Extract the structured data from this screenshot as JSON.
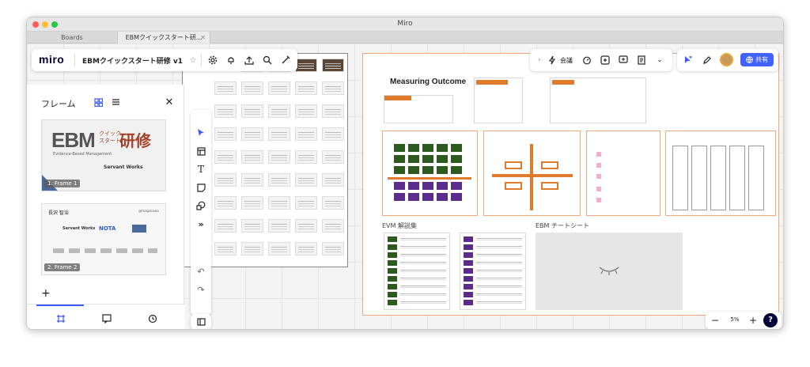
{
  "app": {
    "title": "Miro"
  },
  "tabs": [
    {
      "label": "Boards"
    },
    {
      "label": "EBMクイックスタート研..."
    }
  ],
  "toolbar": {
    "logo": "miro",
    "board_title": "EBMクイックスタート研修 v1",
    "meeting_label": "会議",
    "share_label": "共有"
  },
  "frames_panel": {
    "title": "フレーム",
    "frames": [
      {
        "label": "1. Frame 1",
        "title_big": "EBM",
        "title_small": "クイック\nスタート",
        "title_kanji": "研修",
        "subtitle": "Evidence-Based Management",
        "brand": "Servant Works"
      },
      {
        "label": "2. Frame 2",
        "name": "長沢 智治",
        "handle": "@tnagasawa",
        "brand": "Servant Works",
        "brand2": "NOTA"
      }
    ],
    "add_label": "+"
  },
  "board": {
    "measuring_title": "Measuring Outcome",
    "evm_section_title": "EVM 解説集",
    "cheat_section_title": "EBM チートシート"
  },
  "zoom": {
    "level": "5%"
  },
  "colors": {
    "accent": "#4262ff",
    "orange": "#e07a2c",
    "green": "#2d5a1e",
    "purple": "#5b2d8a"
  },
  "icons": [
    "settings-icon",
    "bell-icon",
    "upload-icon",
    "search-icon",
    "magic-icon",
    "lightning-icon",
    "timer-icon",
    "frame-icon",
    "comment-icon",
    "notes-icon",
    "cursor-icon",
    "pen-icon",
    "avatar",
    "globe-icon",
    "frame-view-icon",
    "comment-panel-icon",
    "history-icon",
    "select-icon",
    "template-icon",
    "text-icon",
    "sticky-icon",
    "shapes-icon",
    "more-icon",
    "undo-icon",
    "redo-icon",
    "panel-icon",
    "help-icon",
    "close-icon",
    "grid-view-icon",
    "list-view-icon"
  ]
}
